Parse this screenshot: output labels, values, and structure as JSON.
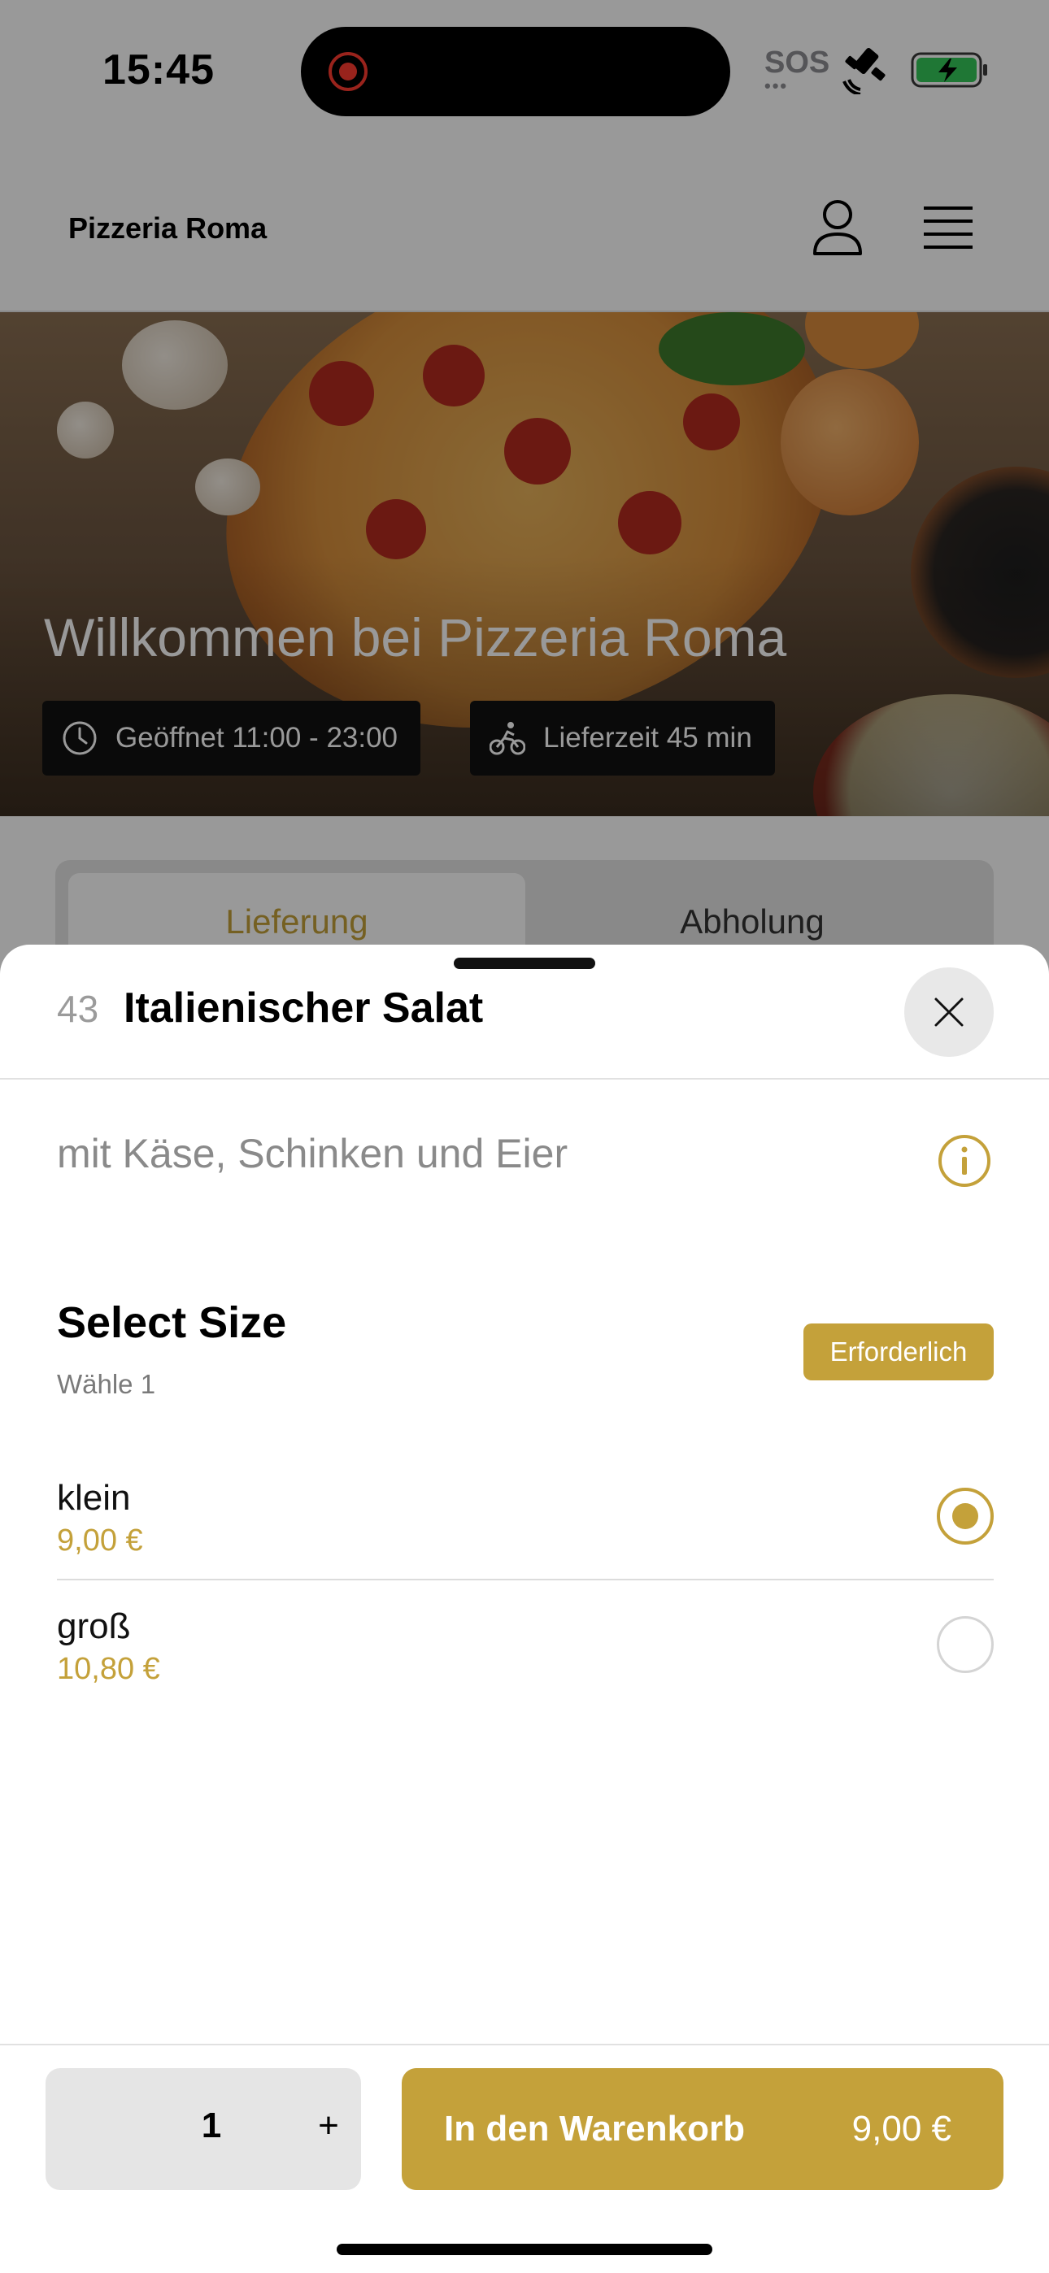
{
  "status_bar": {
    "time": "15:45",
    "sos": "SOS",
    "sos_dots": "•••"
  },
  "header": {
    "brand": "Pizzeria Roma"
  },
  "hero": {
    "title": "Willkommen bei Pizzeria Roma",
    "opening_hours": "Geöffnet 11:00 - 23:00",
    "delivery_time": "Lieferzeit 45 min"
  },
  "tabs": [
    {
      "label": "Lieferung",
      "selected": true
    },
    {
      "label": "Abholung",
      "selected": false
    }
  ],
  "sheet": {
    "item_number": "43",
    "item_title": "Italienischer Salat",
    "description": "mit Käse, Schinken und Eier",
    "size_group": {
      "title": "Select Size",
      "subtitle": "Wähle 1",
      "badge": "Erforderlich",
      "options": [
        {
          "name": "klein",
          "price": "9,00 €",
          "selected": true
        },
        {
          "name": "groß",
          "price": "10,80 €",
          "selected": false
        }
      ]
    },
    "quantity": {
      "value": "1",
      "plus_label": "+"
    },
    "add_to_cart": {
      "label": "In den Warenkorb",
      "price": "9,00 €"
    }
  },
  "colors": {
    "accent": "#c4a13a",
    "dim_overlay": "rgba(0,0,0,0.40)"
  },
  "icons": [
    "record-icon",
    "satellite-icon",
    "battery-charging-icon",
    "user-icon",
    "menu-icon",
    "clock-icon",
    "cyclist-icon",
    "close-icon",
    "info-icon"
  ]
}
